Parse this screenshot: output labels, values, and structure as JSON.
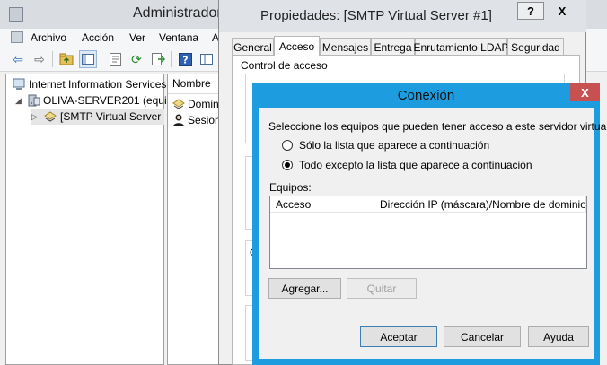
{
  "mmc": {
    "title": "Administrador",
    "menu": [
      "Archivo",
      "Acción",
      "Ver",
      "Ventana",
      "A"
    ],
    "tree": {
      "root": "Internet Information Services",
      "server": "OLIVA-SERVER201 (equip",
      "smtp": "[SMTP Virtual Server"
    },
    "list": {
      "column": "Nombre",
      "items": [
        "Domin",
        "Sesion"
      ]
    }
  },
  "props": {
    "title": "Propiedades: [SMTP Virtual Server #1]",
    "help": "?",
    "close": "X",
    "tabs": [
      "General",
      "Acceso",
      "Mensajes",
      "Entrega",
      "Enrutamiento LDAP",
      "Seguridad"
    ],
    "active_tab": "Acceso",
    "group_label": "Control de acceso",
    "edge_text": "C"
  },
  "conn": {
    "title": "Conexión",
    "close": "X",
    "instruction": "Seleccione los equipos que pueden tener acceso a este servidor virtual:",
    "option_only": "Sólo la lista que aparece a continuación",
    "option_all_except": "Todo excepto la lista que aparece a continuación",
    "selected_option": "all_except",
    "equipos_label": "Equipos:",
    "columns": [
      "Acceso",
      "Dirección IP (máscara)/Nombre de dominio"
    ],
    "rows": [],
    "add_button": "Agregar...",
    "remove_button": "Quitar",
    "ok_button": "Aceptar",
    "cancel_button": "Cancelar",
    "help_button": "Ayuda"
  },
  "colors": {
    "active_border": "#1d9de0",
    "close_button": "#c75050"
  }
}
